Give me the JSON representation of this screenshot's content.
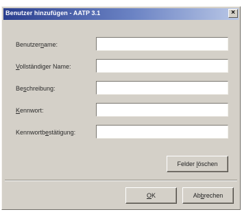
{
  "window": {
    "title": "Benutzer hinzufügen - AATP 3.1",
    "close_glyph": "×"
  },
  "form": {
    "fields": [
      {
        "label_pre": "Benutzer",
        "label_key": "n",
        "label_post": "ame:",
        "value": ""
      },
      {
        "label_pre": "",
        "label_key": "V",
        "label_post": "ollständiger Name:",
        "value": ""
      },
      {
        "label_pre": "Be",
        "label_key": "s",
        "label_post": "chreibung:",
        "value": ""
      },
      {
        "label_pre": "",
        "label_key": "K",
        "label_post": "ennwort:",
        "value": ""
      },
      {
        "label_pre": "Kennwortb",
        "label_key": "e",
        "label_post": "stätigung:",
        "value": ""
      }
    ]
  },
  "buttons": {
    "clear_pre": "Felder ",
    "clear_key": "l",
    "clear_post": "öschen",
    "ok_pre": "",
    "ok_key": "O",
    "ok_post": "K",
    "cancel_pre": "Ab",
    "cancel_key": "b",
    "cancel_post": "rechen"
  },
  "colors": {
    "titlebar_start": "#2a3f8f",
    "titlebar_end": "#b9c7e6",
    "dialog_face": "#d4d0c8"
  }
}
